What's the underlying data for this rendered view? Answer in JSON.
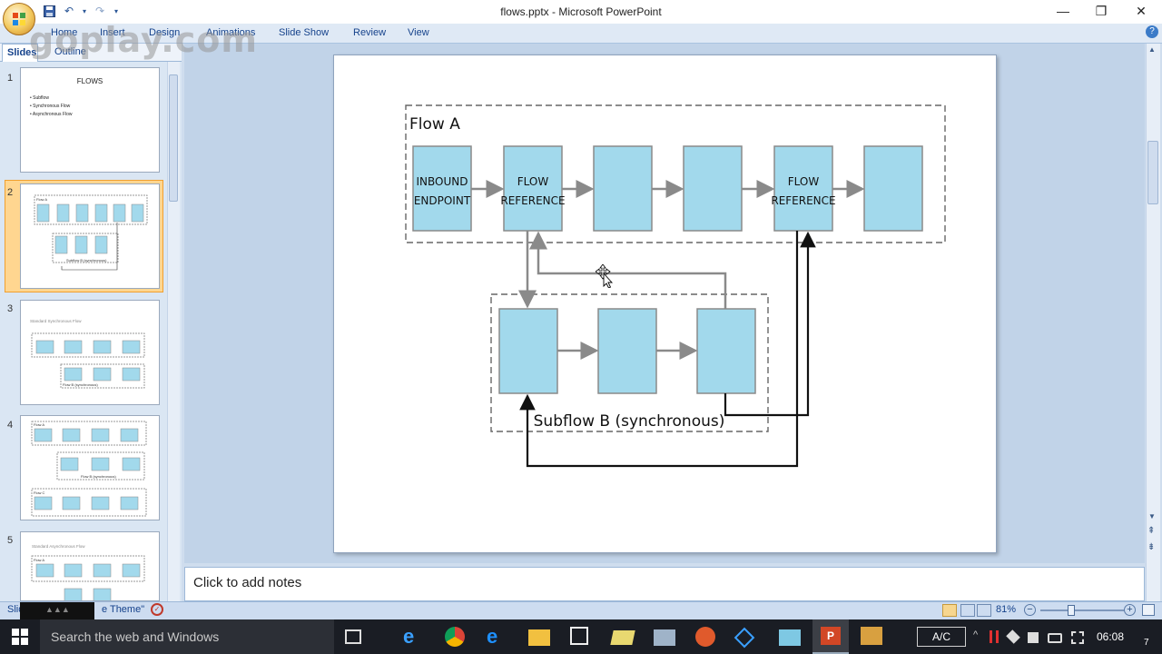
{
  "window": {
    "title": "flows.pptx - Microsoft PowerPoint"
  },
  "ribbon": {
    "tabs": [
      "Home",
      "Insert",
      "Design",
      "Animations",
      "Slide Show",
      "Review",
      "View"
    ]
  },
  "panel": {
    "tab_slides": "Slides",
    "tab_outline": "Outline"
  },
  "watermark": "goplay.com",
  "thumbnails": [
    {
      "number": "1",
      "title": "FLOWS",
      "bullets": [
        "Subflow",
        "Synchronous Flow",
        "Asynchronous Flow"
      ]
    },
    {
      "number": "2",
      "title": "Flow A",
      "caption": "Subflow B (synchronous)"
    },
    {
      "number": "3",
      "title": "Standard Synchronous Flow",
      "caption": "Flow B (synchronous)"
    },
    {
      "number": "4",
      "title": "Flow A",
      "caption": "Flow B (synchronous)",
      "extra": "Flow C"
    },
    {
      "number": "5",
      "title": "Standard Asynchronous Flow",
      "caption": "Flow A"
    }
  ],
  "slide": {
    "flow_a_label": "Flow A",
    "box1_line1": "INBOUND",
    "box1_line2": "ENDPOINT",
    "box2_line1": "FLOW",
    "box2_line2": "REFERENCE",
    "box5_line1": "FLOW",
    "box5_line2": "REFERENCE",
    "subflow_label": "Subflow B (synchronous)"
  },
  "notes": {
    "placeholder": "Click to add notes"
  },
  "status": {
    "slide_label": "Slid",
    "theme_label": "e Theme\"",
    "zoom": "81%"
  },
  "taskbar": {
    "search_placeholder": "Search the web and Windows",
    "ac_label": "A/C",
    "time": "06:08",
    "corner": "7"
  },
  "colors": {
    "box_fill": "#a2d9ec",
    "box_stroke": "#8a8a8a",
    "ribbon_text": "#15428b",
    "selection": "#f9b54c"
  }
}
